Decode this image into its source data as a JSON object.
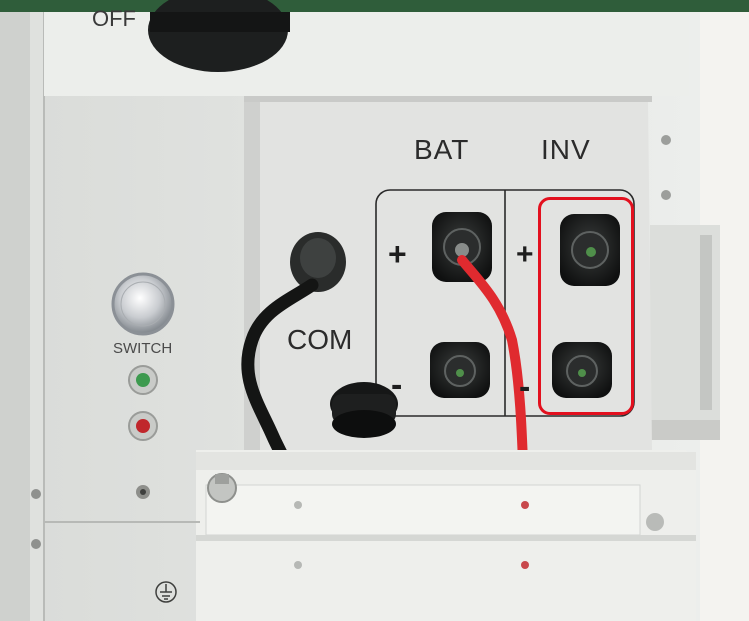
{
  "image": {
    "description_labels": {
      "off": "OFF",
      "bat": "BAT",
      "inv": "INV",
      "com": "COM",
      "switch": "SWITCH",
      "plus": "+",
      "minus": "-"
    },
    "colors": {
      "highlight": "#e3101e",
      "cable_red": "#e02a2f",
      "panel": "#e7e8e6",
      "wall_green": "#2f5d3a"
    }
  }
}
